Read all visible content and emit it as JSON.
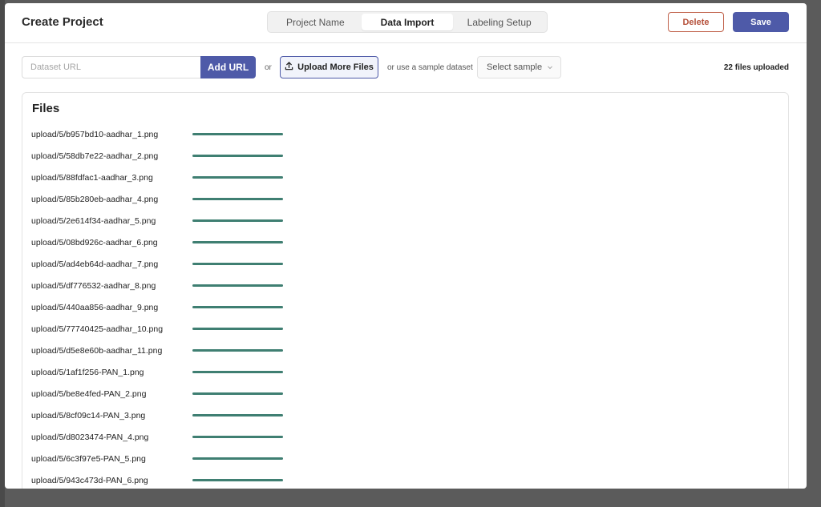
{
  "header": {
    "title": "Create Project",
    "tabs": [
      {
        "label": "Project Name",
        "active": false
      },
      {
        "label": "Data Import",
        "active": true
      },
      {
        "label": "Labeling Setup",
        "active": false
      }
    ],
    "delete_label": "Delete",
    "save_label": "Save"
  },
  "toolbar": {
    "url_placeholder": "Dataset URL",
    "add_url_label": "Add URL",
    "or_label": "or",
    "upload_label": "Upload More Files",
    "sample_text": "or use a sample dataset",
    "sample_select": "Select sample",
    "files_count": "22 files uploaded"
  },
  "files": {
    "title": "Files",
    "items": [
      {
        "name": "upload/5/b957bd10-aadhar_1.png",
        "progress": 1.0
      },
      {
        "name": "upload/5/58db7e22-aadhar_2.png",
        "progress": 1.0
      },
      {
        "name": "upload/5/88fdfac1-aadhar_3.png",
        "progress": 1.0
      },
      {
        "name": "upload/5/85b280eb-aadhar_4.png",
        "progress": 1.0
      },
      {
        "name": "upload/5/2e614f34-aadhar_5.png",
        "progress": 1.0
      },
      {
        "name": "upload/5/08bd926c-aadhar_6.png",
        "progress": 1.0
      },
      {
        "name": "upload/5/ad4eb64d-aadhar_7.png",
        "progress": 1.0
      },
      {
        "name": "upload/5/df776532-aadhar_8.png",
        "progress": 1.0
      },
      {
        "name": "upload/5/440aa856-aadhar_9.png",
        "progress": 1.0
      },
      {
        "name": "upload/5/77740425-aadhar_10.png",
        "progress": 1.0
      },
      {
        "name": "upload/5/d5e8e60b-aadhar_11.png",
        "progress": 1.0
      },
      {
        "name": "upload/5/1af1f256-PAN_1.png",
        "progress": 1.0
      },
      {
        "name": "upload/5/be8e4fed-PAN_2.png",
        "progress": 1.0
      },
      {
        "name": "upload/5/8cf09c14-PAN_3.png",
        "progress": 1.0
      },
      {
        "name": "upload/5/d8023474-PAN_4.png",
        "progress": 1.0
      },
      {
        "name": "upload/5/6c3f97e5-PAN_5.png",
        "progress": 1.0
      },
      {
        "name": "upload/5/943c473d-PAN_6.png",
        "progress": 1.0
      }
    ]
  },
  "colors": {
    "accent": "#4e5aa8",
    "delete": "#b5503a",
    "progress": "#3f7f72"
  },
  "icons": {
    "upload": "upload-icon",
    "select": "chevron-down-icon"
  }
}
